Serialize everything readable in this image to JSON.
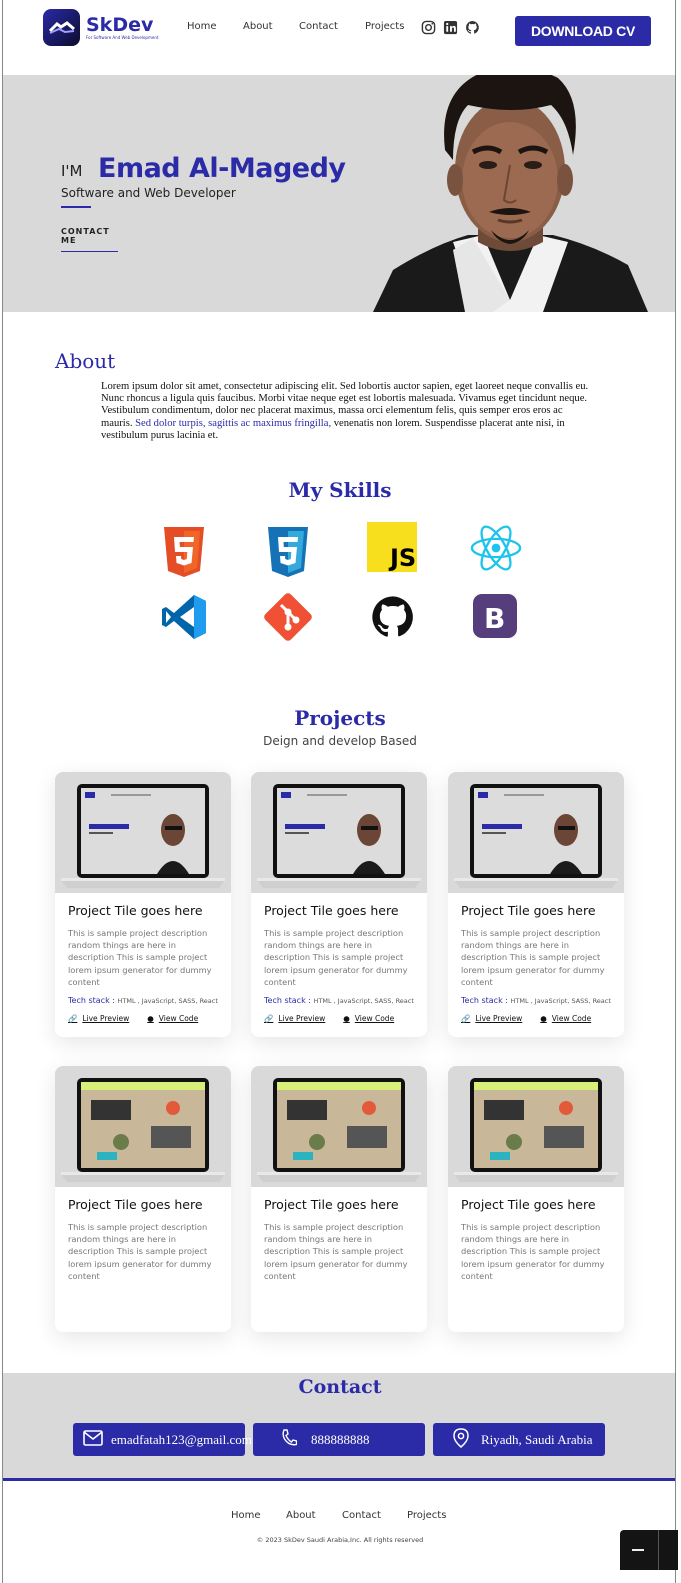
{
  "header": {
    "logo_name": "SkDev",
    "logo_tagline": "For Software And Web Development",
    "nav": [
      "Home",
      "About",
      "Contact",
      "Projects"
    ],
    "social_icons": [
      "instagram-icon",
      "linkedin-icon",
      "github-icon"
    ],
    "cv_button": "DOWNLOAD CV"
  },
  "hero": {
    "greeting": "I'M",
    "name": "Emad Al-Magedy",
    "role": "Software and Web Developer",
    "contact_button": "CONTACT ME"
  },
  "about": {
    "title": "About",
    "text_before": "Lorem ipsum dolor sit amet, consectetur adipiscing elit. Sed lobortis auctor sapien, eget laoreet neque convallis eu. Nunc rhoncus a ligula quis faucibus. Morbi vitae neque eget est lobortis malesuada. Vivamus eget tincidunt neque. Vestibulum condimentum, dolor nec placerat maximus, massa orci elementum felis, quis semper eros eros ac mauris. ",
    "text_link": "Sed dolor turpis, sagittis ac maximus fringilla,",
    "text_after": " venenatis non lorem. Suspendisse placerat ante nisi, in vestibulum purus lacinia et."
  },
  "skills": {
    "title": "My Skills",
    "icons": [
      "html5-icon",
      "css3-icon",
      "javascript-icon",
      "react-icon",
      "vscode-icon",
      "git-icon",
      "github-icon",
      "bootstrap-icon"
    ]
  },
  "projects": {
    "title": "Projects",
    "subtitle": "Deign and develop Based",
    "cards": [
      {
        "title": "Project Tile goes here",
        "desc": "This is sample project description random things are here in description This is sample project lorem ipsum generator for dummy content",
        "tech_label": "Tech stack :",
        "tech": "HTML , JavaScript, SASS, React",
        "live": "Live Preview",
        "code": "View Code"
      },
      {
        "title": "Project Tile goes here",
        "desc": "This is sample project description random things are here in description This is sample project lorem ipsum generator for dummy content",
        "tech_label": "Tech stack :",
        "tech": "HTML , JavaScript, SASS, React",
        "live": "Live Preview",
        "code": "View Code"
      },
      {
        "title": "Project Tile goes here",
        "desc": "This is sample project description random things are here in description This is sample project lorem ipsum generator for dummy content",
        "tech_label": "Tech stack :",
        "tech": "HTML , JavaScript, SASS, React",
        "live": "Live Preview",
        "code": "View Code"
      },
      {
        "title": "Project Tile goes here",
        "desc": "This is sample project description random things are here in description This is sample project lorem ipsum generator for dummy content"
      },
      {
        "title": "Project Tile goes here",
        "desc": "This is sample project description random things are here in description This is sample project lorem ipsum generator for dummy content"
      },
      {
        "title": "Project Tile goes here",
        "desc": "This is sample project description random things are here in description This is sample project lorem ipsum generator for dummy content"
      }
    ]
  },
  "contact": {
    "title": "Contact",
    "email": "emadfatah123@gmail.com",
    "phone": "888888888",
    "location": "Riyadh, Saudi Arabia"
  },
  "footer": {
    "nav": [
      "Home",
      "About",
      "Contact",
      "Projects"
    ],
    "copyright": "© 2023 SkDev Saudi Arabia,Inc. All rights reserved"
  },
  "colors": {
    "accent": "#2b2ba8",
    "hero_bg": "#d9d9d9"
  }
}
